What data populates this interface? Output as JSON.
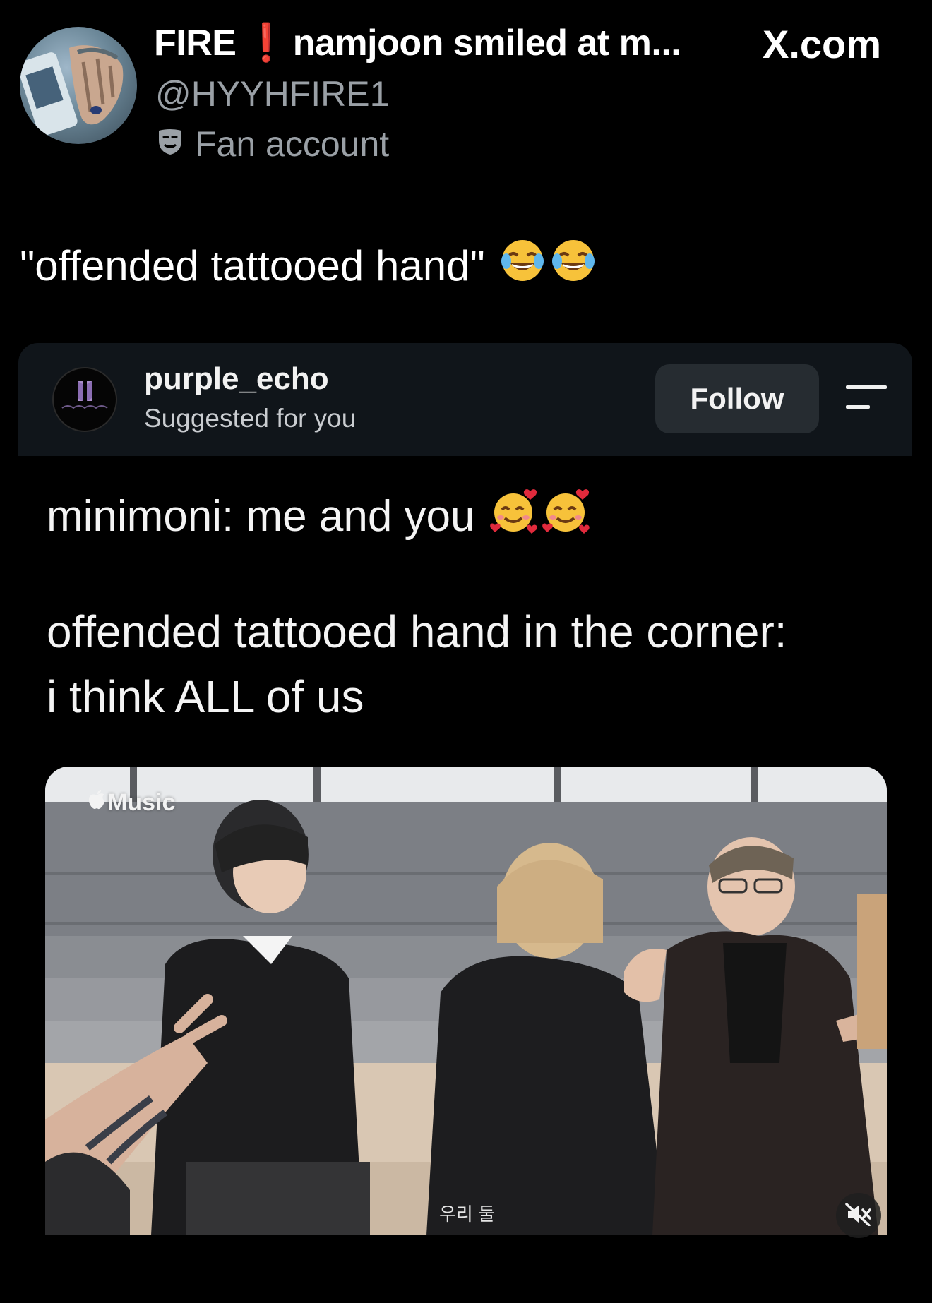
{
  "tweet": {
    "display_name": "FIRE",
    "display_name_rest": "namjoon smiled at m...",
    "handle": "@HYYHFIRE1",
    "account_label": "Fan account",
    "site": "X.com",
    "text": "\"offended tattooed hand\"",
    "text_emojis": [
      "face-with-tears-of-joy",
      "face-with-tears-of-joy"
    ]
  },
  "embed": {
    "username": "purple_echo",
    "subtitle": "Suggested for you",
    "follow_label": "Follow",
    "line1": "minimoni: me and you",
    "line1_emojis": [
      "smiling-face-with-hearts",
      "smiling-face-with-hearts"
    ],
    "line2": "offended tattooed hand in the corner:",
    "line3": "i think ALL of us",
    "video": {
      "watermark": "Music",
      "caption": "우리 둘"
    }
  },
  "colors": {
    "background": "#000000",
    "muted_text": "#9aa0a6",
    "bang_red": "#e0245e",
    "card_header": "#10151a",
    "follow_button": "#262c31"
  }
}
